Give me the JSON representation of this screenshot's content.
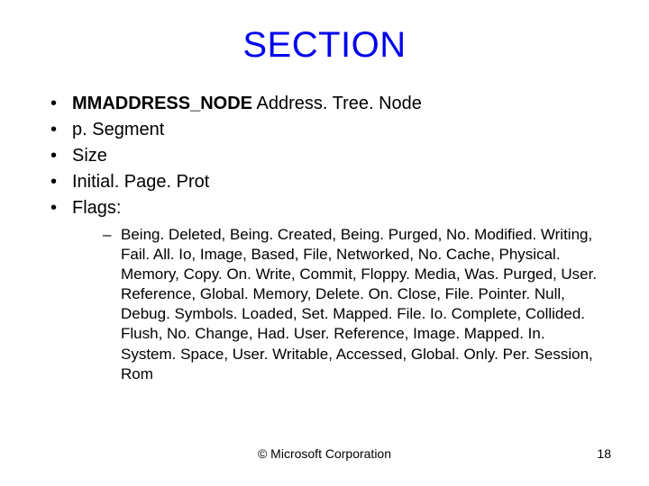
{
  "title": "SECTION",
  "items": [
    {
      "bold": "MMADDRESS_NODE",
      "rest": " Address. Tree. Node"
    },
    {
      "text": "p. Segment"
    },
    {
      "text": "Size"
    },
    {
      "text": "Initial. Page. Prot"
    },
    {
      "text": "Flags:"
    }
  ],
  "flags_detail": "Being. Deleted, Being. Created, Being. Purged, No. Modified. Writing, Fail. All. Io, Image, Based, File, Networked, No. Cache, Physical. Memory, Copy. On. Write, Commit, Floppy. Media, Was. Purged, User. Reference, Global. Memory, Delete. On. Close, File. Pointer. Null, Debug. Symbols. Loaded, Set. Mapped. File. Io. Complete, Collided. Flush, No. Change, Had. User. Reference, Image. Mapped. In. System. Space, User. Writable, Accessed, Global. Only. Per. Session, Rom",
  "footer": {
    "copyright": "© Microsoft Corporation",
    "page": "18"
  }
}
